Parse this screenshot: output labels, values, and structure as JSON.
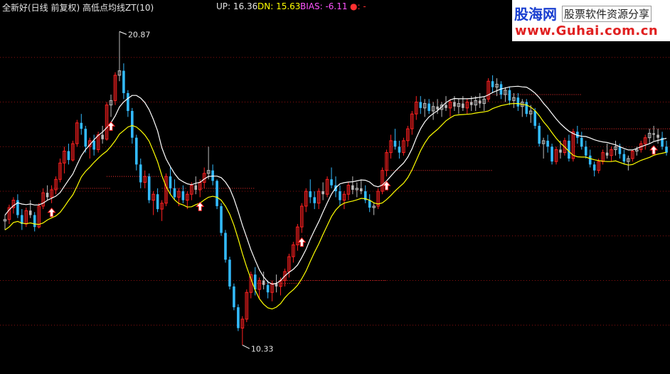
{
  "header": {
    "title": "全新好(日线 前复权) 高低点均线ZT(10)",
    "up_text": "UP: 16.36",
    "dn_text": "DN: 15.63",
    "bias_text": "BIAS: -6.11",
    "dot_text": "●: -"
  },
  "watermark": {
    "cn_name": "股海网",
    "slogan": "股票软件资源分享",
    "url": "www.Guhai.com.cn"
  },
  "colors": {
    "background": "#000000",
    "up_candle": "#ff2020",
    "down_candle": "#33bbff",
    "flat_candle": "#bbbbbb",
    "up_line": "#ffffff",
    "dn_line": "#ffff00",
    "dotted_level": "#ff3030",
    "grid": "#8a1010"
  },
  "chart_data": {
    "type": "candlestick",
    "ylim": [
      9.5,
      21.5
    ],
    "grid": "dotted-horizontal",
    "annotations": [
      {
        "label": "20.87",
        "index": 27,
        "price": 20.87,
        "kind": "max"
      },
      {
        "label": "10.33",
        "index": 56,
        "price": 10.33,
        "kind": "min"
      }
    ],
    "arrows": [
      11,
      25,
      46,
      70,
      90,
      153
    ],
    "levels": [
      {
        "start": 11,
        "end": 25,
        "price": 15.6
      },
      {
        "start": 24,
        "end": 37,
        "price": 16.0
      },
      {
        "start": 37,
        "end": 43,
        "price": 15.6
      },
      {
        "start": 46,
        "end": 59,
        "price": 15.6
      },
      {
        "start": 59,
        "end": 70,
        "price": 12.4
      },
      {
        "start": 65,
        "end": 90,
        "price": 12.5
      },
      {
        "start": 90,
        "end": 115,
        "price": 16.2
      },
      {
        "start": 115,
        "end": 136,
        "price": 18.75
      },
      {
        "start": 136,
        "end": 157,
        "price": 17.6
      }
    ],
    "candles": [
      [
        14.5,
        14.7,
        14.2,
        14.55
      ],
      [
        14.55,
        15.05,
        14.4,
        14.95
      ],
      [
        14.95,
        15.3,
        14.75,
        15.2
      ],
      [
        15.2,
        15.4,
        14.6,
        14.7
      ],
      [
        14.7,
        14.9,
        14.2,
        14.4
      ],
      [
        14.4,
        14.95,
        14.3,
        14.85
      ],
      [
        14.85,
        15.2,
        14.6,
        14.7
      ],
      [
        14.7,
        14.8,
        14.15,
        14.3
      ],
      [
        14.3,
        15.1,
        14.25,
        15.0
      ],
      [
        15.0,
        15.6,
        14.9,
        15.45
      ],
      [
        15.45,
        15.7,
        15.2,
        15.3
      ],
      [
        15.3,
        15.7,
        15.1,
        15.55
      ],
      [
        15.55,
        16.0,
        15.4,
        15.9
      ],
      [
        15.9,
        16.6,
        15.8,
        16.45
      ],
      [
        16.45,
        17.0,
        16.1,
        16.85
      ],
      [
        16.85,
        17.1,
        16.4,
        16.55
      ],
      [
        16.55,
        17.2,
        16.5,
        17.1
      ],
      [
        17.1,
        17.9,
        17.0,
        17.8
      ],
      [
        17.8,
        18.1,
        17.4,
        17.6
      ],
      [
        17.6,
        17.7,
        16.8,
        17.0
      ],
      [
        17.0,
        17.3,
        16.6,
        17.2
      ],
      [
        17.2,
        17.4,
        16.7,
        16.9
      ],
      [
        16.9,
        17.5,
        16.8,
        17.4
      ],
      [
        17.4,
        17.7,
        17.1,
        17.25
      ],
      [
        17.25,
        18.5,
        17.2,
        18.4
      ],
      [
        18.4,
        18.75,
        18.0,
        18.55
      ],
      [
        18.55,
        19.5,
        18.4,
        19.4
      ],
      [
        19.4,
        20.87,
        19.2,
        19.55
      ],
      [
        19.55,
        19.8,
        18.6,
        18.8
      ],
      [
        18.8,
        18.9,
        18.0,
        18.2
      ],
      [
        18.2,
        18.3,
        17.1,
        17.3
      ],
      [
        17.3,
        17.4,
        16.2,
        16.4
      ],
      [
        16.4,
        16.6,
        15.6,
        15.8
      ],
      [
        15.8,
        16.2,
        15.6,
        16.0
      ],
      [
        16.0,
        16.1,
        15.1,
        15.2
      ],
      [
        15.2,
        15.5,
        14.7,
        15.4
      ],
      [
        15.4,
        15.6,
        14.8,
        14.9
      ],
      [
        14.9,
        15.2,
        14.5,
        15.1
      ],
      [
        15.1,
        16.1,
        15.0,
        16.0
      ],
      [
        16.0,
        16.3,
        15.4,
        15.6
      ],
      [
        15.6,
        15.9,
        15.2,
        15.3
      ],
      [
        15.3,
        15.6,
        15.0,
        15.5
      ],
      [
        15.5,
        15.7,
        15.1,
        15.2
      ],
      [
        15.2,
        15.5,
        14.9,
        15.4
      ],
      [
        15.4,
        15.8,
        15.2,
        15.7
      ],
      [
        15.7,
        16.0,
        15.4,
        15.55
      ],
      [
        15.55,
        15.9,
        15.3,
        15.8
      ],
      [
        15.8,
        16.3,
        15.6,
        16.1
      ],
      [
        16.1,
        17.0,
        15.9,
        16.2
      ],
      [
        16.2,
        16.4,
        15.7,
        15.85
      ],
      [
        15.85,
        15.9,
        14.9,
        15.0
      ],
      [
        15.0,
        15.1,
        14.0,
        14.1
      ],
      [
        14.1,
        14.2,
        13.1,
        13.2
      ],
      [
        13.2,
        13.3,
        12.2,
        12.3
      ],
      [
        12.3,
        12.4,
        11.5,
        11.6
      ],
      [
        11.6,
        11.7,
        10.8,
        10.9
      ],
      [
        10.9,
        11.3,
        10.33,
        11.2
      ],
      [
        11.2,
        12.2,
        11.1,
        12.1
      ],
      [
        12.1,
        12.8,
        11.9,
        12.7
      ],
      [
        12.7,
        12.95,
        12.0,
        12.2
      ],
      [
        12.2,
        12.6,
        11.9,
        12.5
      ],
      [
        12.5,
        12.8,
        12.2,
        12.35
      ],
      [
        12.35,
        12.5,
        11.9,
        12.1
      ],
      [
        12.1,
        12.5,
        11.8,
        12.4
      ],
      [
        12.4,
        12.7,
        12.1,
        12.3
      ],
      [
        12.3,
        12.6,
        12.0,
        12.5
      ],
      [
        12.5,
        12.9,
        12.3,
        12.8
      ],
      [
        12.8,
        13.4,
        12.6,
        13.3
      ],
      [
        13.3,
        13.8,
        13.1,
        13.7
      ],
      [
        13.7,
        14.4,
        13.5,
        14.3
      ],
      [
        14.3,
        15.1,
        14.1,
        15.0
      ],
      [
        15.0,
        15.6,
        14.8,
        15.5
      ],
      [
        15.5,
        15.9,
        15.1,
        15.3
      ],
      [
        15.3,
        15.5,
        14.9,
        15.1
      ],
      [
        15.1,
        15.6,
        14.9,
        15.5
      ],
      [
        15.5,
        15.8,
        15.2,
        15.4
      ],
      [
        15.4,
        16.0,
        15.3,
        15.9
      ],
      [
        15.9,
        16.3,
        15.6,
        15.7
      ],
      [
        15.7,
        16.0,
        15.3,
        15.5
      ],
      [
        15.5,
        15.7,
        15.0,
        15.2
      ],
      [
        15.2,
        15.5,
        14.9,
        15.4
      ],
      [
        15.4,
        15.8,
        15.2,
        15.7
      ],
      [
        15.7,
        16.0,
        15.4,
        15.55
      ],
      [
        15.55,
        15.8,
        15.3,
        15.6
      ],
      [
        15.6,
        15.9,
        15.4,
        15.5
      ],
      [
        15.5,
        15.7,
        15.1,
        15.2
      ],
      [
        15.2,
        15.4,
        14.8,
        14.95
      ],
      [
        14.95,
        15.1,
        14.7,
        15.0
      ],
      [
        15.0,
        15.6,
        14.9,
        15.5
      ],
      [
        15.5,
        16.3,
        15.4,
        16.2
      ],
      [
        16.2,
        16.9,
        16.0,
        16.8
      ],
      [
        16.8,
        17.4,
        16.6,
        17.2
      ],
      [
        17.2,
        17.6,
        16.9,
        17.0
      ],
      [
        17.0,
        17.2,
        16.6,
        16.8
      ],
      [
        16.8,
        17.3,
        16.7,
        17.2
      ],
      [
        17.2,
        17.7,
        17.0,
        17.6
      ],
      [
        17.6,
        18.2,
        17.4,
        18.1
      ],
      [
        18.1,
        18.7,
        17.9,
        18.5
      ],
      [
        18.5,
        18.7,
        18.1,
        18.3
      ],
      [
        18.3,
        18.6,
        18.0,
        18.45
      ],
      [
        18.45,
        18.6,
        18.1,
        18.2
      ],
      [
        18.2,
        18.5,
        17.9,
        18.35
      ],
      [
        18.35,
        18.6,
        18.1,
        18.25
      ],
      [
        18.25,
        18.5,
        18.0,
        18.4
      ],
      [
        18.4,
        18.7,
        18.2,
        18.3
      ],
      [
        18.3,
        18.6,
        18.0,
        18.5
      ],
      [
        18.5,
        18.7,
        18.2,
        18.35
      ],
      [
        18.35,
        18.6,
        18.1,
        18.45
      ],
      [
        18.45,
        18.7,
        18.2,
        18.3
      ],
      [
        18.3,
        18.6,
        18.1,
        18.5
      ],
      [
        18.5,
        18.7,
        18.2,
        18.4
      ],
      [
        18.4,
        18.7,
        18.2,
        18.55
      ],
      [
        18.55,
        18.8,
        18.3,
        18.45
      ],
      [
        18.45,
        18.7,
        18.2,
        18.6
      ],
      [
        18.6,
        19.3,
        18.5,
        19.2
      ],
      [
        19.2,
        19.4,
        18.8,
        19.0
      ],
      [
        19.0,
        19.3,
        18.7,
        19.1
      ],
      [
        19.1,
        19.2,
        18.6,
        18.75
      ],
      [
        18.75,
        19.0,
        18.5,
        18.9
      ],
      [
        18.9,
        19.0,
        18.4,
        18.55
      ],
      [
        18.55,
        18.8,
        18.3,
        18.65
      ],
      [
        18.65,
        18.8,
        18.2,
        18.35
      ],
      [
        18.35,
        18.6,
        18.0,
        18.5
      ],
      [
        18.5,
        18.6,
        18.0,
        18.1
      ],
      [
        18.1,
        18.4,
        17.8,
        18.2
      ],
      [
        18.2,
        18.3,
        17.6,
        17.7
      ],
      [
        17.7,
        17.8,
        17.0,
        17.1
      ],
      [
        17.1,
        17.3,
        16.6,
        17.2
      ],
      [
        17.2,
        17.4,
        16.8,
        17.0
      ],
      [
        17.0,
        17.1,
        16.4,
        16.5
      ],
      [
        16.5,
        17.0,
        16.4,
        16.9
      ],
      [
        16.9,
        17.2,
        16.6,
        16.8
      ],
      [
        16.8,
        17.3,
        16.7,
        17.2
      ],
      [
        17.2,
        17.4,
        16.5,
        16.6
      ],
      [
        16.6,
        17.6,
        16.5,
        17.5
      ],
      [
        17.5,
        17.7,
        17.1,
        17.3
      ],
      [
        17.3,
        17.5,
        16.9,
        17.0
      ],
      [
        17.0,
        17.2,
        16.6,
        16.7
      ],
      [
        16.7,
        16.9,
        16.3,
        16.4
      ],
      [
        16.4,
        16.5,
        16.0,
        16.2
      ],
      [
        16.2,
        16.6,
        16.1,
        16.5
      ],
      [
        16.5,
        16.9,
        16.4,
        16.8
      ],
      [
        16.8,
        17.1,
        16.6,
        16.7
      ],
      [
        16.7,
        17.0,
        16.5,
        16.9
      ],
      [
        16.9,
        17.2,
        16.7,
        17.0
      ],
      [
        17.0,
        17.1,
        16.6,
        16.75
      ],
      [
        16.75,
        16.9,
        16.4,
        16.5
      ],
      [
        16.5,
        16.7,
        16.2,
        16.6
      ],
      [
        16.6,
        16.9,
        16.5,
        16.85
      ],
      [
        16.85,
        17.0,
        16.7,
        16.9
      ],
      [
        16.9,
        17.2,
        16.8,
        17.1
      ],
      [
        17.1,
        17.4,
        16.9,
        17.3
      ],
      [
        17.3,
        17.6,
        17.1,
        17.45
      ],
      [
        17.45,
        17.7,
        17.2,
        17.4
      ],
      [
        17.4,
        17.6,
        17.1,
        17.3
      ],
      [
        17.3,
        17.5,
        16.9,
        17.0
      ],
      [
        17.0,
        17.2,
        16.7,
        16.8
      ]
    ]
  }
}
